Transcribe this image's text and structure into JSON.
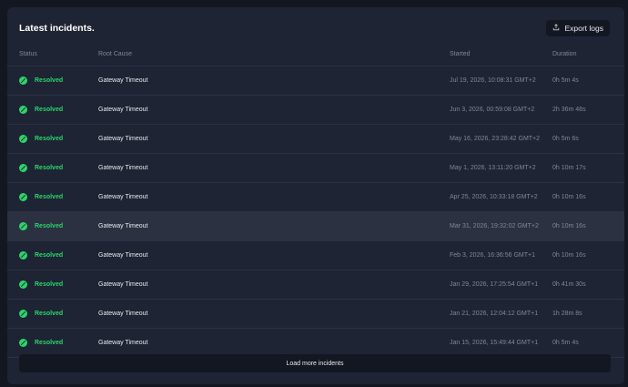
{
  "header": {
    "title": "Latest incidents.",
    "export_label": "Export logs"
  },
  "columns": {
    "status": "Status",
    "root_cause": "Root Cause",
    "started": "Started",
    "duration": "Duration"
  },
  "rows": [
    {
      "status": "Resolved",
      "cause": "Gateway Timeout",
      "started": "Jul 19, 2026, 10:08:31 GMT+2",
      "duration": "0h 5m 4s"
    },
    {
      "status": "Resolved",
      "cause": "Gateway Timeout",
      "started": "Jun 3, 2026, 00:59:08 GMT+2",
      "duration": "2h 36m 48s"
    },
    {
      "status": "Resolved",
      "cause": "Gateway Timeout",
      "started": "May 16, 2026, 23:28:42 GMT+2",
      "duration": "0h 5m 6s"
    },
    {
      "status": "Resolved",
      "cause": "Gateway Timeout",
      "started": "May 1, 2026, 13:11:20 GMT+2",
      "duration": "0h 10m 17s"
    },
    {
      "status": "Resolved",
      "cause": "Gateway Timeout",
      "started": "Apr 25, 2026, 10:33:18 GMT+2",
      "duration": "0h 10m 16s"
    },
    {
      "status": "Resolved",
      "cause": "Gateway Timeout",
      "started": "Mar 31, 2026, 19:32:02 GMT+2",
      "duration": "0h 10m 16s"
    },
    {
      "status": "Resolved",
      "cause": "Gateway Timeout",
      "started": "Feb 3, 2026, 16:36:56 GMT+1",
      "duration": "0h 10m 16s"
    },
    {
      "status": "Resolved",
      "cause": "Gateway Timeout",
      "started": "Jan 29, 2026, 17:25:54 GMT+1",
      "duration": "0h 41m 30s"
    },
    {
      "status": "Resolved",
      "cause": "Gateway Timeout",
      "started": "Jan 21, 2026, 12:04:12 GMT+1",
      "duration": "1h 28m 8s"
    },
    {
      "status": "Resolved",
      "cause": "Gateway Timeout",
      "started": "Jan 15, 2026, 15:49:44 GMT+1",
      "duration": "0h 5m 4s"
    }
  ],
  "load_more_label": "Load more incidents",
  "colors": {
    "resolved": "#2bd46b",
    "background": "#131722",
    "card": "#1e2433"
  },
  "icons": {
    "export": "upload-icon",
    "status": "check-circle-icon"
  }
}
